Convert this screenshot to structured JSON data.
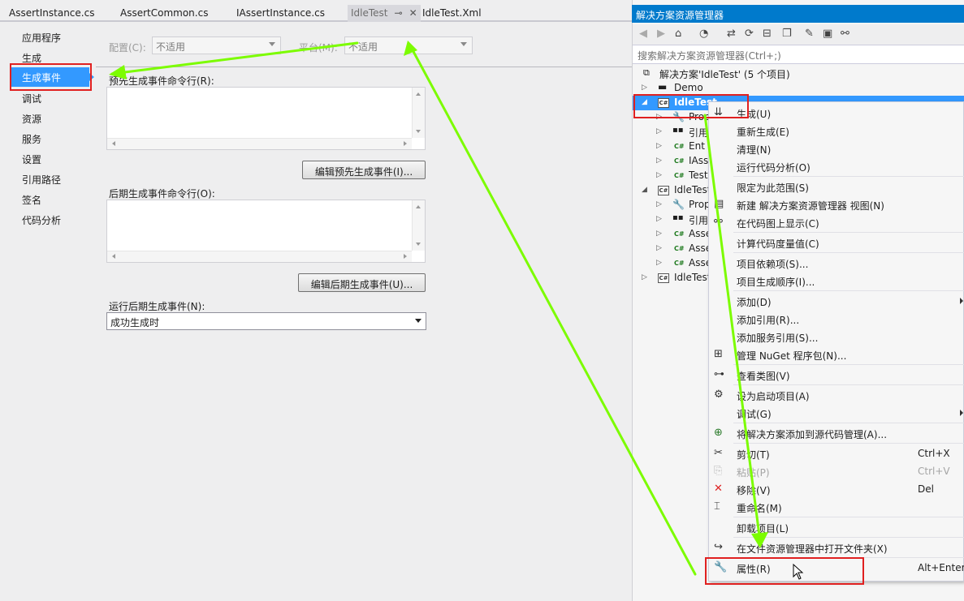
{
  "doc_tabs": [
    {
      "label": "AssertInstance.cs"
    },
    {
      "label": "AssertCommon.cs"
    },
    {
      "label": "IAssertInstance.cs"
    },
    {
      "label": "IdleTest",
      "active": true
    },
    {
      "label": "IdleTest.Xml"
    }
  ],
  "nav": {
    "items": [
      "应用程序",
      "生成",
      "生成事件",
      "调试",
      "资源",
      "服务",
      "设置",
      "引用路径",
      "签名",
      "代码分析"
    ],
    "active_index": 2
  },
  "config": {
    "config_label": "配置(C):",
    "config_value": "不适用",
    "platform_label": "平台(M):",
    "platform_value": "不适用"
  },
  "build_events": {
    "pre_label": "预先生成事件命令行(R):",
    "pre_value": "",
    "edit_pre_button": "编辑预先生成事件(I)...",
    "post_label": "后期生成事件命令行(O):",
    "post_value": "",
    "edit_post_button": "编辑后期生成事件(U)...",
    "run_label": "运行后期生成事件(N):",
    "run_value": "成功生成时"
  },
  "solution_explorer": {
    "title": "解决方案资源管理器",
    "search_placeholder": "搜索解决方案资源管理器(Ctrl+;)",
    "solution": "解决方案'IdleTest' (5 个项目)",
    "tree": [
      {
        "label": "Demo",
        "kind": "folder"
      },
      {
        "label": "IdleTest",
        "kind": "project",
        "selected": true
      },
      {
        "label": "Prop",
        "kind": "props"
      },
      {
        "label": "引用",
        "kind": "refs"
      },
      {
        "label": "Ent",
        "kind": "cs"
      },
      {
        "label": "IAss",
        "kind": "cs"
      },
      {
        "label": "Test",
        "kind": "cs"
      },
      {
        "label": "IdleTest",
        "kind": "project"
      },
      {
        "label": "Prop",
        "kind": "props"
      },
      {
        "label": "引用",
        "kind": "refs"
      },
      {
        "label": "Asse",
        "kind": "cs"
      },
      {
        "label": "Asse",
        "kind": "cs"
      },
      {
        "label": "Asse",
        "kind": "cs"
      },
      {
        "label": "IdleTest",
        "kind": "project"
      }
    ]
  },
  "context_menu": {
    "items": [
      {
        "label": "生成(U)",
        "icon": "build-icon"
      },
      {
        "label": "重新生成(E)"
      },
      {
        "label": "清理(N)"
      },
      {
        "label": "运行代码分析(O)"
      },
      {
        "label": "限定为此范围(S)"
      },
      {
        "label": "新建 解决方案资源管理器 视图(N)",
        "icon": "new-view-icon"
      },
      {
        "label": "在代码图上显示(C)",
        "icon": "code-map-icon"
      },
      {
        "label": "计算代码度量值(C)"
      },
      {
        "label": "项目依赖项(S)..."
      },
      {
        "label": "项目生成顺序(I)..."
      },
      {
        "label": "添加(D)",
        "submenu": true
      },
      {
        "label": "添加引用(R)..."
      },
      {
        "label": "添加服务引用(S)..."
      },
      {
        "label": "管理 NuGet 程序包(N)...",
        "icon": "nuget-icon"
      },
      {
        "label": "查看类图(V)",
        "icon": "class-diagram-icon"
      },
      {
        "label": "设为启动项目(A)",
        "icon": "gear-icon"
      },
      {
        "label": "调试(G)",
        "submenu": true
      },
      {
        "label": "将解决方案添加到源代码管理(A)...",
        "icon": "source-control-icon"
      },
      {
        "label": "剪切(T)",
        "shortcut": "Ctrl+X",
        "icon": "cut-icon"
      },
      {
        "label": "粘贴(P)",
        "shortcut": "Ctrl+V",
        "icon": "paste-icon",
        "disabled": true
      },
      {
        "label": "移除(V)",
        "shortcut": "Del",
        "icon": "remove-icon"
      },
      {
        "label": "重命名(M)",
        "icon": "rename-icon"
      },
      {
        "label": "卸载项目(L)"
      },
      {
        "label": "在文件资源管理器中打开文件夹(X)",
        "icon": "open-folder-icon"
      },
      {
        "label": "属性(R)",
        "shortcut": "Alt+Enter",
        "icon": "wrench-icon"
      }
    ]
  },
  "colors": {
    "accent": "#3399ff",
    "title_bar": "#007acc",
    "annotation_box": "#e02020",
    "annotation_arrow": "#7cfc00"
  }
}
